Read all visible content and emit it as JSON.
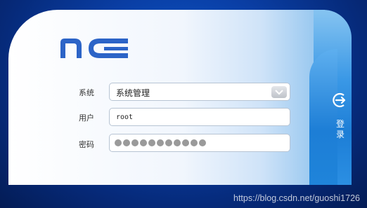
{
  "brand": {
    "logo_text": "NC"
  },
  "form": {
    "system": {
      "label": "系统",
      "value": "系统管理"
    },
    "user": {
      "label": "用户",
      "value": "root"
    },
    "password": {
      "label": "密码",
      "masked_length": 11
    }
  },
  "login": {
    "label": "登录",
    "icon": "login-arrow-icon"
  },
  "watermark": "https://blog.csdn.net/guoshi1726",
  "colors": {
    "accent_blue": "#2c64c7",
    "login_blue": "#1d7ed6",
    "background_dark": "#041c55"
  }
}
